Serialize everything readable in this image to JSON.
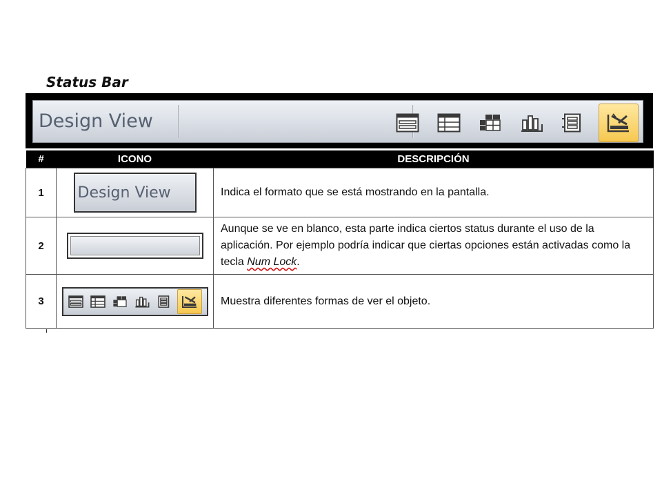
{
  "title": "Status Bar",
  "statusbar": {
    "label": "Design View",
    "icons": [
      "form-view-icon",
      "datasheet-view-icon",
      "pivottable-view-icon",
      "pivotchart-view-icon",
      "layout-view-icon",
      "design-view-icon"
    ],
    "active_icon": "design-view-icon"
  },
  "table": {
    "headers": [
      "#",
      "ICONO",
      "DESCRIPCIÓN"
    ],
    "rows": [
      {
        "num": "1",
        "icon_label": "Design View",
        "desc": "Indica el formato que se está mostrando en la pantalla."
      },
      {
        "num": "2",
        "desc_before": "Aunque se ve en blanco, esta parte indica ciertos status durante el uso de la aplicación. Por ejemplo podría indicar que ciertas opciones están activadas como la tecla ",
        "desc_em": "Num Lock",
        "desc_after": "."
      },
      {
        "num": "3",
        "desc": "Muestra diferentes formas de ver el objeto."
      }
    ]
  },
  "colors": {
    "active_highlight": "#f6c850",
    "header_bg": "#000000"
  }
}
